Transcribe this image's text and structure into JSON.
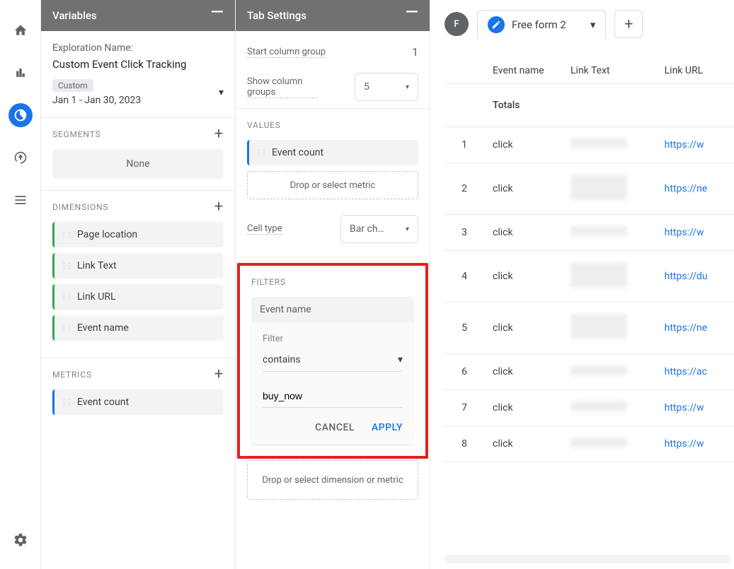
{
  "variables": {
    "title": "Variables",
    "explorationNameLabel": "Exploration Name:",
    "explorationName": "Custom Event Click Tracking",
    "dateBadge": "Custom",
    "dateRange": "Jan 1 - Jan 30, 2023",
    "segments": {
      "label": "SEGMENTS",
      "none": "None"
    },
    "dimensions": {
      "label": "DIMENSIONS",
      "items": [
        {
          "label": "Page location"
        },
        {
          "label": "Link Text"
        },
        {
          "label": "Link URL"
        },
        {
          "label": "Event name"
        }
      ]
    },
    "metrics": {
      "label": "METRICS",
      "items": [
        {
          "label": "Event count"
        }
      ]
    }
  },
  "tabSettings": {
    "title": "Tab Settings",
    "startColGroupLabel": "Start column group",
    "startColGroupValue": "1",
    "showColGroupsLabel": "Show column groups",
    "showColGroupsValue": "5",
    "valuesLabel": "VALUES",
    "valueChip": "Event count",
    "dropMetric": "Drop or select metric",
    "cellTypeLabel": "Cell type",
    "cellTypeValue": "Bar ch…",
    "filtersLabel": "FILTERS",
    "filterDim": "Event name",
    "filterWord": "Filter",
    "filterOp": "contains",
    "filterValue": "buy_now",
    "cancel": "CANCEL",
    "apply": "APPLY",
    "dropDimOrMetric": "Drop or select dimension or metric"
  },
  "canvas": {
    "avatar": "F",
    "tabName": "Free form 2",
    "headers": [
      "Event name",
      "Link Text",
      "Link URL"
    ],
    "totalsLabel": "Totals",
    "rows": [
      {
        "idx": "1",
        "event": "click",
        "url": "https://w"
      },
      {
        "idx": "2",
        "event": "click",
        "url": "https://ne"
      },
      {
        "idx": "3",
        "event": "click",
        "url": "https://w"
      },
      {
        "idx": "4",
        "event": "click",
        "url": "https://du"
      },
      {
        "idx": "5",
        "event": "click",
        "url": "https://ne"
      },
      {
        "idx": "6",
        "event": "click",
        "url": "https://ac"
      },
      {
        "idx": "7",
        "event": "click",
        "url": "https://w"
      },
      {
        "idx": "8",
        "event": "click",
        "url": "https://w"
      }
    ]
  }
}
